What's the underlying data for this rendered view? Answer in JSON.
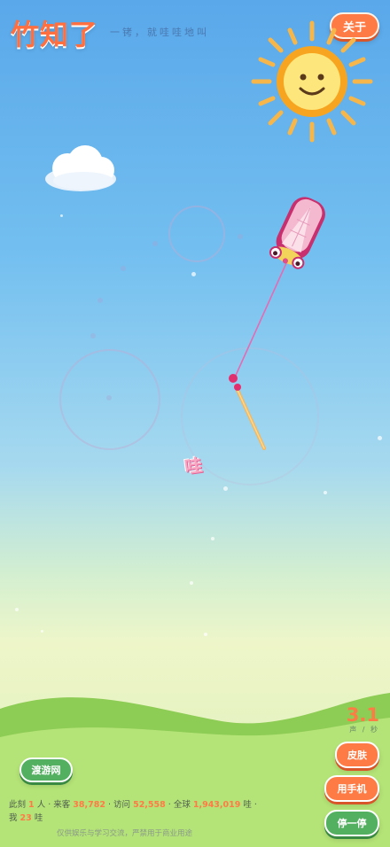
{
  "app": {
    "brand": "竹知了",
    "tagline": "一铐，就哇哇地叫",
    "about_label": "关于"
  },
  "scene": {
    "sun_icon": "smiling-sun-icon",
    "cloud_icon": "cloud-icon",
    "cicada_icon": "cicada-on-stick-icon",
    "wa_text": "哇"
  },
  "speed": {
    "value": "3.1",
    "unit": "声 / 秒"
  },
  "buttons": {
    "skin": "皮肤",
    "phone": "用手机",
    "pause": "停一停",
    "site": "渡游网"
  },
  "stats": {
    "prefix": "此刻",
    "online": "1",
    "online_unit": "人 · 来客",
    "visitors": "38,782",
    "visits_label": "· 访问",
    "visits": "52,558",
    "global_label": "· 全球",
    "global": "1,943,019",
    "global_unit": "哇 · 我",
    "mine": "23",
    "mine_unit": "哇"
  },
  "footer": {
    "disclaimer": "仅供娱乐与学习交流，严禁用于商业用途"
  },
  "colors": {
    "accent_orange": "#ff7b45",
    "accent_green": "#52b060",
    "sky_top": "#5aa8ea",
    "grass": "#a8dc6c"
  }
}
